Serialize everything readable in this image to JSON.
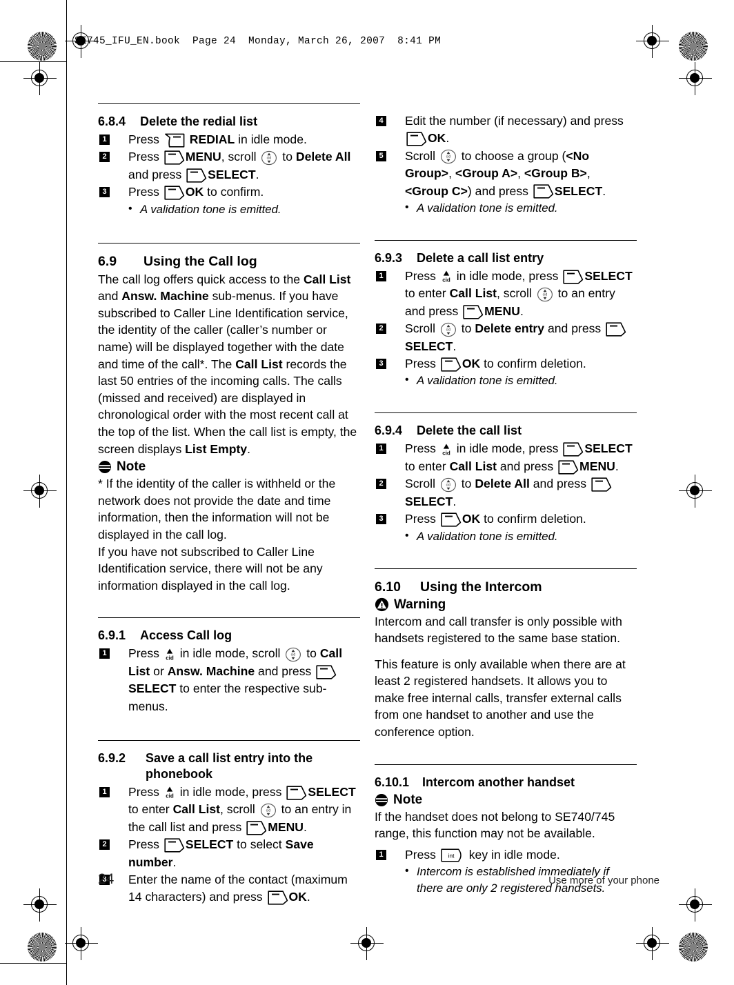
{
  "header": {
    "book_line": "SE745_IFU_EN.book  Page 24  Monday, March 26, 2007  8:41 PM"
  },
  "footer": {
    "page_number": "24",
    "running_title": "Use more of your phone"
  },
  "icons": {
    "softkey": "softkey-icon",
    "softkey_left": "redial-softkey-icon",
    "scroll": "scroll-updown-icon",
    "cid": "cid-key-icon",
    "int": "int-key-icon",
    "note": "note-icon",
    "warning": "warning-icon",
    "cid_label": "cid",
    "int_label": "int"
  },
  "left_column": {
    "section_684": {
      "number": "6.8.4",
      "title": "Delete the redial list",
      "steps": [
        {
          "marker": "1",
          "parts": [
            {
              "t": "text",
              "v": "Press "
            },
            {
              "t": "icon",
              "v": "softkey_left"
            },
            {
              "t": "bold",
              "v": " REDIAL"
            },
            {
              "t": "text",
              "v": " in idle mode."
            }
          ]
        },
        {
          "marker": "2",
          "parts": [
            {
              "t": "text",
              "v": "Press "
            },
            {
              "t": "icon",
              "v": "softkey"
            },
            {
              "t": "bold",
              "v": "MENU"
            },
            {
              "t": "text",
              "v": ", scroll "
            },
            {
              "t": "icon",
              "v": "scroll"
            },
            {
              "t": "text",
              "v": " to "
            },
            {
              "t": "bold",
              "v": "Delete All"
            },
            {
              "t": "text",
              "v": " and press "
            },
            {
              "t": "icon",
              "v": "softkey"
            },
            {
              "t": "bold",
              "v": "SELECT"
            },
            {
              "t": "text",
              "v": "."
            }
          ]
        },
        {
          "marker": "3",
          "parts": [
            {
              "t": "text",
              "v": "Press "
            },
            {
              "t": "icon",
              "v": "softkey"
            },
            {
              "t": "bold",
              "v": "OK"
            },
            {
              "t": "text",
              "v": " to confirm."
            }
          ]
        }
      ],
      "notes": [
        "A validation tone is emitted."
      ]
    },
    "section_69": {
      "number": "6.9",
      "title": "Using the Call log",
      "body_parts": [
        {
          "t": "text",
          "v": "The call log offers quick access to the "
        },
        {
          "t": "bold",
          "v": "Call List"
        },
        {
          "t": "text",
          "v": " and "
        },
        {
          "t": "bold",
          "v": "Answ. Machine"
        },
        {
          "t": "text",
          "v": " sub-menus. If you have subscribed to Caller Line Identification service, the identity of the caller (caller’s number or name) will be displayed together with the date and time of the call*. The "
        },
        {
          "t": "bold",
          "v": "Call List"
        },
        {
          "t": "text",
          "v": " records the last 50 entries of the incoming calls. The calls (missed and received) are displayed in chronological order with the most recent call at the top of the list. When the call list is empty, the screen displays "
        },
        {
          "t": "bold",
          "v": "List Empty"
        },
        {
          "t": "text",
          "v": "."
        }
      ],
      "note_label": "Note",
      "note_paragraphs": [
        "* If the identity of the caller is withheld or the network does not provide the date and time information, then the information will not be displayed in the call log.",
        "If you have not subscribed to Caller Line Identification service, there will not be any information displayed in the call log."
      ]
    },
    "section_691": {
      "number": "6.9.1",
      "title": "Access Call log",
      "steps": [
        {
          "marker": "1",
          "parts": [
            {
              "t": "text",
              "v": " Press "
            },
            {
              "t": "icon",
              "v": "cid"
            },
            {
              "t": "text",
              "v": " in idle mode, scroll "
            },
            {
              "t": "icon",
              "v": "scroll"
            },
            {
              "t": "text",
              "v": " to "
            },
            {
              "t": "bold",
              "v": "Call List"
            },
            {
              "t": "text",
              "v": " or "
            },
            {
              "t": "bold",
              "v": "Answ. Machine"
            },
            {
              "t": "text",
              "v": " and press "
            },
            {
              "t": "icon",
              "v": "softkey"
            },
            {
              "t": "bold",
              "v": "SELECT"
            },
            {
              "t": "text",
              "v": " to enter the respective sub-menus."
            }
          ]
        }
      ]
    },
    "section_692": {
      "number": "6.9.2",
      "title": "Save a call list entry into the",
      "title_line2": "phonebook",
      "steps": [
        {
          "marker": "1",
          "parts": [
            {
              "t": "text",
              "v": "Press "
            },
            {
              "t": "icon",
              "v": "cid"
            },
            {
              "t": "text",
              "v": " in idle mode, press "
            },
            {
              "t": "icon",
              "v": "softkey"
            },
            {
              "t": "bold",
              "v": "SELECT"
            },
            {
              "t": "text",
              "v": " to enter "
            },
            {
              "t": "bold",
              "v": "Call List"
            },
            {
              "t": "text",
              "v": ", scroll "
            },
            {
              "t": "icon",
              "v": "scroll"
            },
            {
              "t": "text",
              "v": " to an entry in the call list and press "
            },
            {
              "t": "icon",
              "v": "softkey"
            },
            {
              "t": "bold",
              "v": "MENU"
            },
            {
              "t": "text",
              "v": "."
            }
          ]
        },
        {
          "marker": "2",
          "parts": [
            {
              "t": "text",
              "v": "Press "
            },
            {
              "t": "icon",
              "v": "softkey"
            },
            {
              "t": "bold",
              "v": "SELECT"
            },
            {
              "t": "text",
              "v": " to select "
            },
            {
              "t": "bold",
              "v": "Save number"
            },
            {
              "t": "text",
              "v": "."
            }
          ]
        },
        {
          "marker": "3",
          "parts": [
            {
              "t": "text",
              "v": "Enter the name of the contact (maximum 14 characters) and press "
            },
            {
              "t": "icon",
              "v": "softkey"
            },
            {
              "t": "bold",
              "v": "OK"
            },
            {
              "t": "text",
              "v": "."
            }
          ]
        }
      ]
    }
  },
  "right_column": {
    "continued_steps": {
      "steps": [
        {
          "marker": "4",
          "parts": [
            {
              "t": "text",
              "v": "Edit the number (if necessary) and press "
            },
            {
              "t": "icon",
              "v": "softkey"
            },
            {
              "t": "bold",
              "v": "OK"
            },
            {
              "t": "text",
              "v": "."
            }
          ]
        },
        {
          "marker": "5",
          "parts": [
            {
              "t": "text",
              "v": "Scroll "
            },
            {
              "t": "icon",
              "v": "scroll"
            },
            {
              "t": "text",
              "v": " to choose a group ("
            },
            {
              "t": "bold",
              "v": "<No Group>"
            },
            {
              "t": "text",
              "v": ", "
            },
            {
              "t": "bold",
              "v": "<Group A>"
            },
            {
              "t": "text",
              "v": ", "
            },
            {
              "t": "bold",
              "v": "<Group B>"
            },
            {
              "t": "text",
              "v": ", "
            },
            {
              "t": "bold",
              "v": "<Group C>"
            },
            {
              "t": "text",
              "v": ") and press "
            },
            {
              "t": "icon",
              "v": "softkey"
            },
            {
              "t": "bold",
              "v": "SELECT"
            },
            {
              "t": "text",
              "v": "."
            }
          ]
        }
      ],
      "notes": [
        "A validation tone is emitted."
      ]
    },
    "section_693": {
      "number": "6.9.3",
      "title": "Delete a call list entry",
      "steps": [
        {
          "marker": "1",
          "parts": [
            {
              "t": "text",
              "v": "Press "
            },
            {
              "t": "icon",
              "v": "cid"
            },
            {
              "t": "text",
              "v": " in idle mode, press "
            },
            {
              "t": "icon",
              "v": "softkey"
            },
            {
              "t": "bold",
              "v": "SELECT"
            },
            {
              "t": "text",
              "v": " to enter "
            },
            {
              "t": "bold",
              "v": "Call List"
            },
            {
              "t": "text",
              "v": ", scroll "
            },
            {
              "t": "icon",
              "v": "scroll"
            },
            {
              "t": "text",
              "v": " to an entry and press "
            },
            {
              "t": "icon",
              "v": "softkey"
            },
            {
              "t": "bold",
              "v": "MENU"
            },
            {
              "t": "text",
              "v": "."
            }
          ]
        },
        {
          "marker": "2",
          "parts": [
            {
              "t": "text",
              "v": "Scroll "
            },
            {
              "t": "icon",
              "v": "scroll"
            },
            {
              "t": "text",
              "v": " to "
            },
            {
              "t": "bold",
              "v": "Delete entry"
            },
            {
              "t": "text",
              "v": " and press "
            },
            {
              "t": "icon",
              "v": "softkey"
            },
            {
              "t": "bold",
              "v": "SELECT"
            },
            {
              "t": "text",
              "v": "."
            }
          ]
        },
        {
          "marker": "3",
          "parts": [
            {
              "t": "text",
              "v": "Press "
            },
            {
              "t": "icon",
              "v": "softkey"
            },
            {
              "t": "bold",
              "v": "OK"
            },
            {
              "t": "text",
              "v": " to confirm deletion."
            }
          ]
        }
      ],
      "notes": [
        "A validation tone is emitted."
      ]
    },
    "section_694": {
      "number": "6.9.4",
      "title": "Delete the call list",
      "steps": [
        {
          "marker": "1",
          "parts": [
            {
              "t": "text",
              "v": "Press "
            },
            {
              "t": "icon",
              "v": "cid"
            },
            {
              "t": "text",
              "v": " in idle mode, press "
            },
            {
              "t": "icon",
              "v": "softkey"
            },
            {
              "t": "bold",
              "v": "SELECT"
            },
            {
              "t": "text",
              "v": " to enter "
            },
            {
              "t": "bold",
              "v": "Call List"
            },
            {
              "t": "text",
              "v": " and press "
            },
            {
              "t": "icon",
              "v": "softkey"
            },
            {
              "t": "bold",
              "v": "MENU"
            },
            {
              "t": "text",
              "v": "."
            }
          ]
        },
        {
          "marker": "2",
          "parts": [
            {
              "t": "text",
              "v": "Scroll "
            },
            {
              "t": "icon",
              "v": "scroll"
            },
            {
              "t": "text",
              "v": " to "
            },
            {
              "t": "bold",
              "v": "Delete All"
            },
            {
              "t": "text",
              "v": " and press "
            },
            {
              "t": "icon",
              "v": "softkey"
            },
            {
              "t": "bold",
              "v": "SELECT"
            },
            {
              "t": "text",
              "v": "."
            }
          ]
        },
        {
          "marker": "3",
          "parts": [
            {
              "t": "text",
              "v": "Press "
            },
            {
              "t": "icon",
              "v": "softkey"
            },
            {
              "t": "bold",
              "v": "OK"
            },
            {
              "t": "text",
              "v": " to confirm deletion."
            }
          ]
        }
      ],
      "notes": [
        "A validation tone is emitted."
      ]
    },
    "section_610": {
      "number": "6.10",
      "title": "Using the Intercom",
      "warning_label": "Warning",
      "paragraphs": [
        "Intercom and call transfer is only possible with handsets registered to the same base station.",
        "This feature is only available when there are at least 2 registered handsets. It allows you to make free internal calls, transfer external calls from one handset to another and use the conference option."
      ]
    },
    "section_6101": {
      "number": "6.10.1",
      "title": "Intercom another handset",
      "note_label": "Note",
      "note_paragraph": "If the handset does not belong to SE740/745 range, this function may not be available.",
      "steps": [
        {
          "marker": "1",
          "parts": [
            {
              "t": "text",
              "v": "Press "
            },
            {
              "t": "icon",
              "v": "int"
            },
            {
              "t": "text",
              "v": " key in idle mode."
            }
          ]
        }
      ],
      "notes": [
        "Intercom is established immediately if there are only 2 registered handsets."
      ]
    }
  }
}
